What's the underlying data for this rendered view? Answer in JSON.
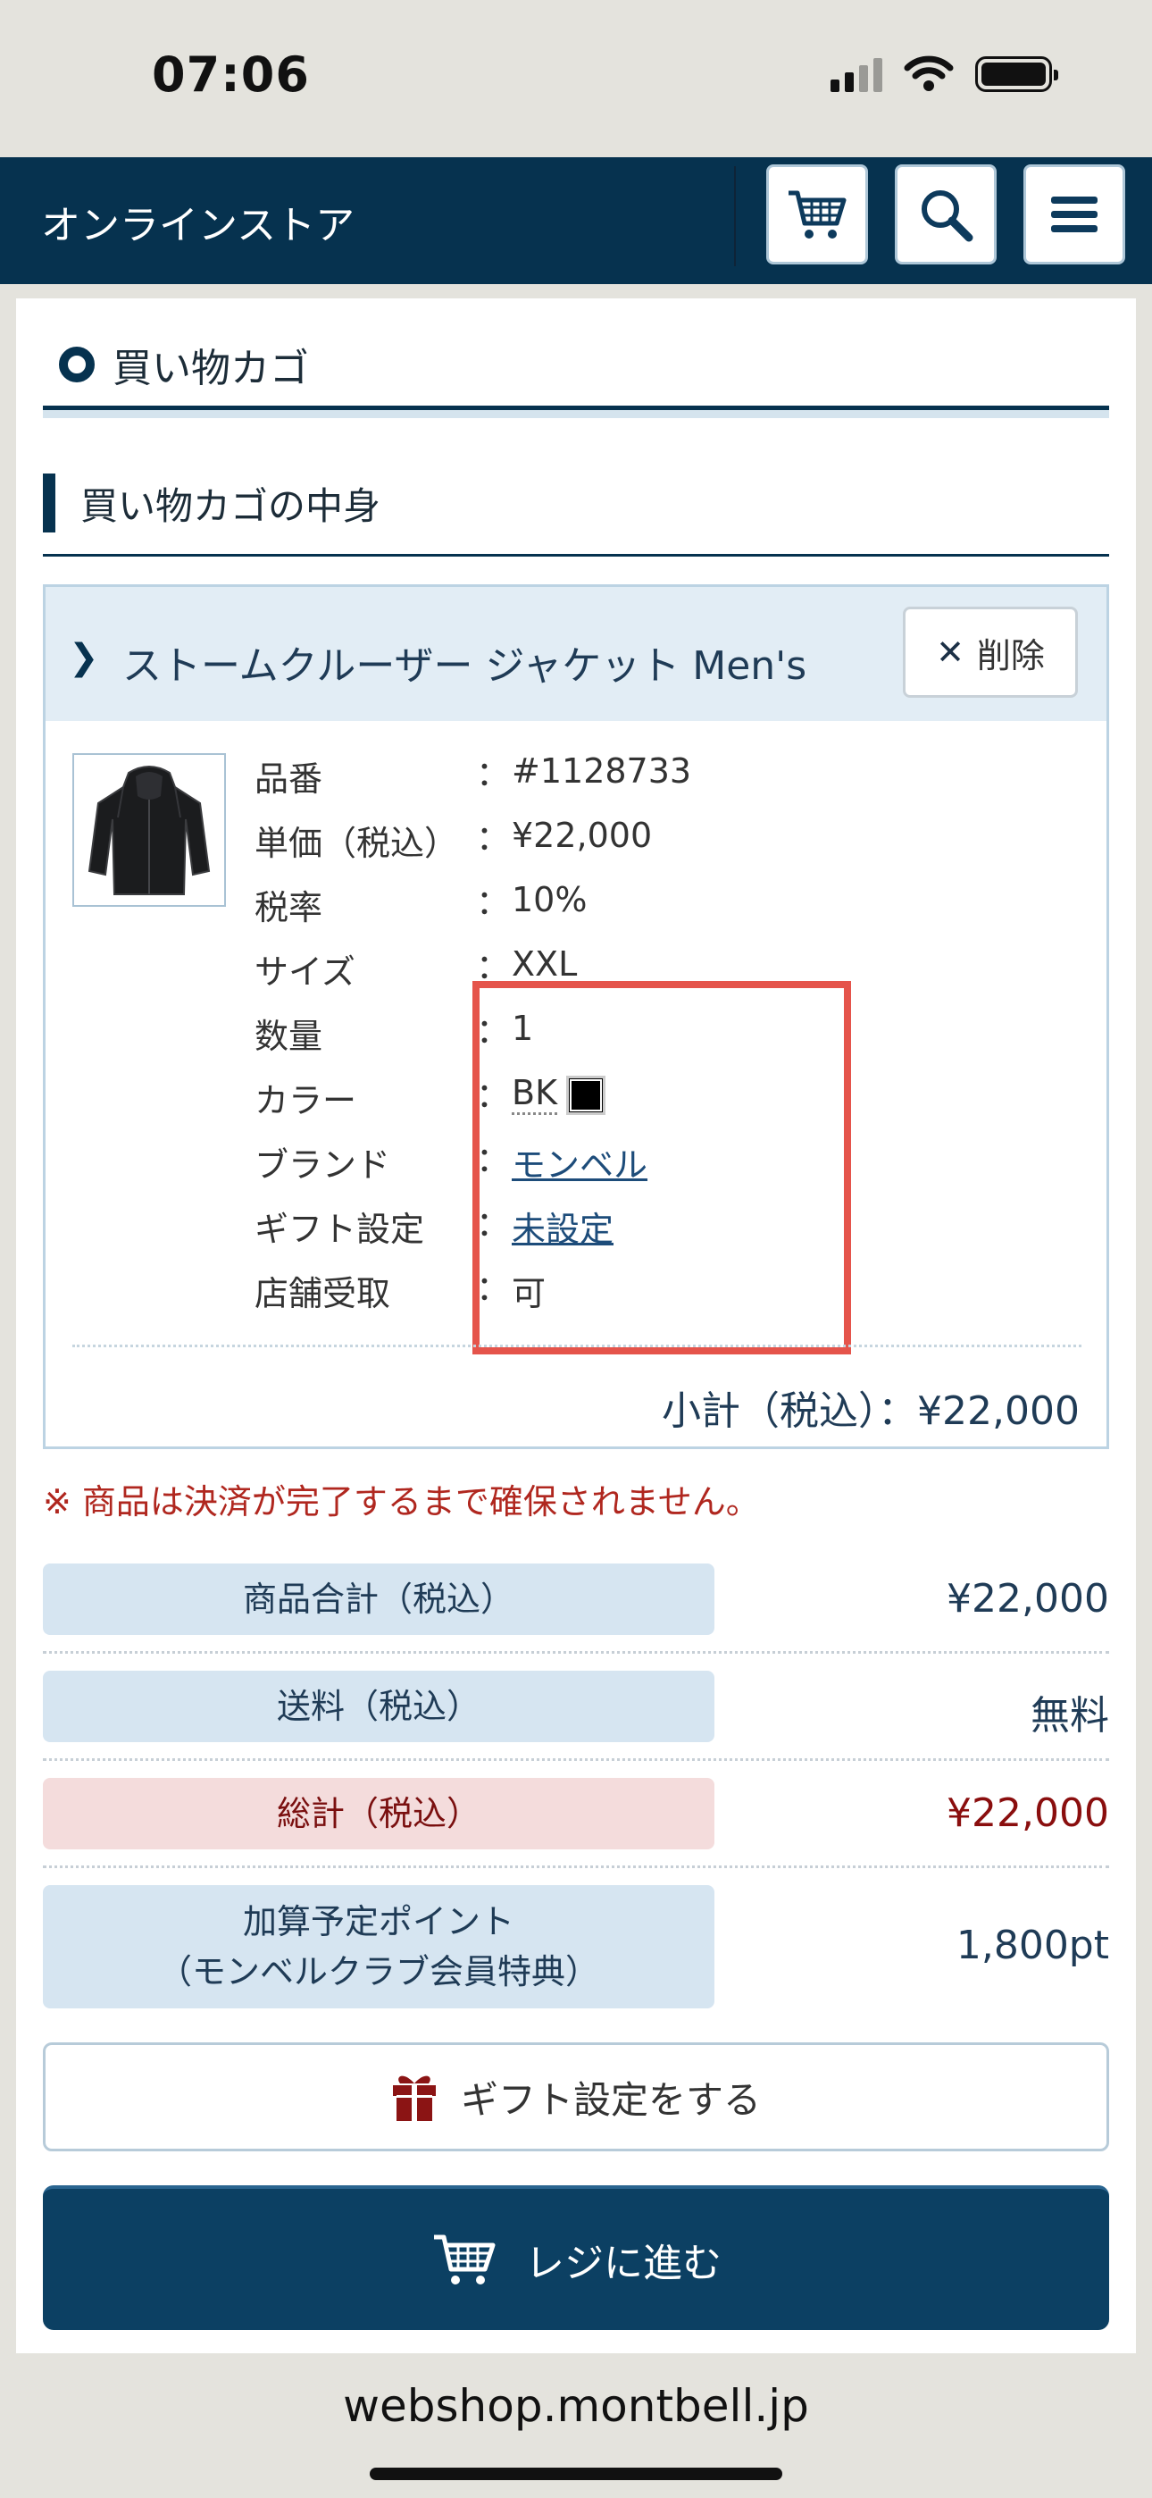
{
  "status_bar": {
    "time": "07:06"
  },
  "header": {
    "store_title": "オンラインストア"
  },
  "page": {
    "title": "買い物カゴ",
    "section_title": "買い物カゴの中身"
  },
  "item": {
    "name": "ストームクルーザー ジャケット Men's",
    "delete_label": "削除",
    "specs": [
      {
        "label": "品番",
        "value": "#1128733"
      },
      {
        "label": "単価（税込）",
        "value": "¥22,000"
      },
      {
        "label": "税率",
        "value": "10%"
      },
      {
        "label": "サイズ",
        "value": "XXL"
      },
      {
        "label": "数量",
        "value": "1"
      },
      {
        "label": "カラー",
        "value": "BK"
      },
      {
        "label": "ブランド",
        "value": "モンベル"
      },
      {
        "label": "ギフト設定",
        "value": "未設定"
      },
      {
        "label": "店舗受取",
        "value": "可"
      }
    ],
    "separator": "：",
    "subtotal": "小計（税込）：¥22,000"
  },
  "notice": "※ 商品は決済が完了するまで確保されません。",
  "summary": {
    "merchandise_label": "商品合計（税込）",
    "merchandise_value": "¥22,000",
    "shipping_label": "送料（税込）",
    "shipping_value": "無料",
    "total_label": "総計（税込）",
    "total_value": "¥22,000",
    "points_label_line1": "加算予定ポイント",
    "points_label_line2": "（モンベルクラブ会員特典）",
    "points_value": "1,800pt"
  },
  "buttons": {
    "gift": "ギフト設定をする",
    "checkout": "レジに進む"
  },
  "browser": {
    "url": "webshop.montbell.jp"
  },
  "colors": {
    "header_bg": "#06324f",
    "accent_red": "#b0271f",
    "highlight": "#e5544b"
  }
}
